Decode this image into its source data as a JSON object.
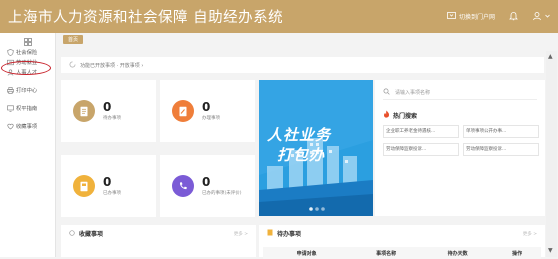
{
  "header": {
    "title": "上海市人力资源和社会保障 自助经办系统",
    "portal_label": "切换到门户网",
    "bell_icon": "bell-icon",
    "user_icon": "user-icon"
  },
  "sidebar": {
    "items": [
      {
        "label": "社会保险",
        "icon": "shield-icon"
      },
      {
        "label": "劳动就业",
        "icon": "id-card-icon"
      },
      {
        "label": "人事人才",
        "icon": "person-icon"
      },
      {
        "label": "打印中心",
        "icon": "printer-icon"
      },
      {
        "label": "权平指南",
        "icon": "monitor-icon"
      },
      {
        "label": "收藏事项",
        "icon": "heart-icon"
      }
    ]
  },
  "tabs": [
    {
      "label": "首页"
    }
  ],
  "breadcrumb": {
    "text": "功能已开放事项 · 开放事项 ›"
  },
  "stats": [
    {
      "value": "0",
      "label": "待办事项",
      "color": "#c8a56a"
    },
    {
      "value": "0",
      "label": "办理事项",
      "color": "#ef7e3a"
    },
    {
      "value": "0",
      "label": "已办事项",
      "color": "#f0b23c"
    },
    {
      "value": "0",
      "label": "已办的事项(未评价)",
      "color": "#7b5bd6"
    }
  ],
  "banner": {
    "line1": "人社业务",
    "line2": "打包办",
    "bg_color": "#2b9fe0"
  },
  "search": {
    "placeholder": "请输入事项名称"
  },
  "hot": {
    "title": "热门搜索",
    "items": [
      "企业职工养老金待遇核...",
      "单项事项公开办事...",
      "劳动保障监察投诉...",
      "劳动保障监察投诉..."
    ]
  },
  "favorites": {
    "title": "收藏事项",
    "more": "更多 >"
  },
  "todo": {
    "title": "待办事项",
    "more": "更多 >",
    "columns": [
      "申请对象",
      "事项名称",
      "待办天数",
      "操作"
    ]
  },
  "colors": {
    "brand": "#c8a56a",
    "highlight": "#c8232c"
  }
}
